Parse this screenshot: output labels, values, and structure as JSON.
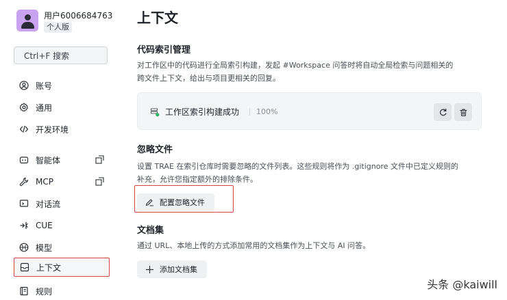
{
  "user": {
    "name": "用户6006684763",
    "plan": "个人版"
  },
  "search": {
    "label": "Ctrl+F 搜索"
  },
  "sidebar": {
    "items": [
      {
        "label": "账号",
        "icon": "account-icon"
      },
      {
        "label": "通用",
        "icon": "gear-icon"
      },
      {
        "label": "开发环境",
        "icon": "code-icon"
      },
      {
        "label": "智能体",
        "icon": "agent-icon",
        "external": true
      },
      {
        "label": "MCP",
        "icon": "wrench-icon",
        "external": true
      },
      {
        "label": "对话流",
        "icon": "chat-icon"
      },
      {
        "label": "CUE",
        "icon": "cue-icon"
      },
      {
        "label": "模型",
        "icon": "model-icon"
      },
      {
        "label": "上下文",
        "icon": "context-icon",
        "active": true
      },
      {
        "label": "规则",
        "icon": "rules-icon"
      }
    ]
  },
  "main": {
    "title": "上下文",
    "code_index": {
      "title": "代码索引管理",
      "desc_line1": "对工作区中的代码进行全局索引构建，发起 #Workspace 问答时将自动全局检索与问题相关的",
      "desc_line2": "跨文件上下文，给出与项目更相关的回复。",
      "status": "工作区索引构建成功",
      "progress": "100%"
    },
    "ignore_files": {
      "title": "忽略文件",
      "desc_line1": "设置 TRAE 在索引仓库时需要忽略的文件列表。这些规则将作为 .gitignore 文件中已定义规则的",
      "desc_line2": "补充，允许您指定额外的排除条件。",
      "button": "配置忽略文件"
    },
    "docs": {
      "title": "文档集",
      "desc": "通过 URL、本地上传的方式添加常用的文档集作为上下文与 AI 问答。",
      "button": "添加文档集"
    }
  },
  "watermark": "头条 @kaiwill",
  "colors": {
    "highlight": "#d64545",
    "avatar": "#c9a3f0",
    "success": "#2fb36a"
  }
}
